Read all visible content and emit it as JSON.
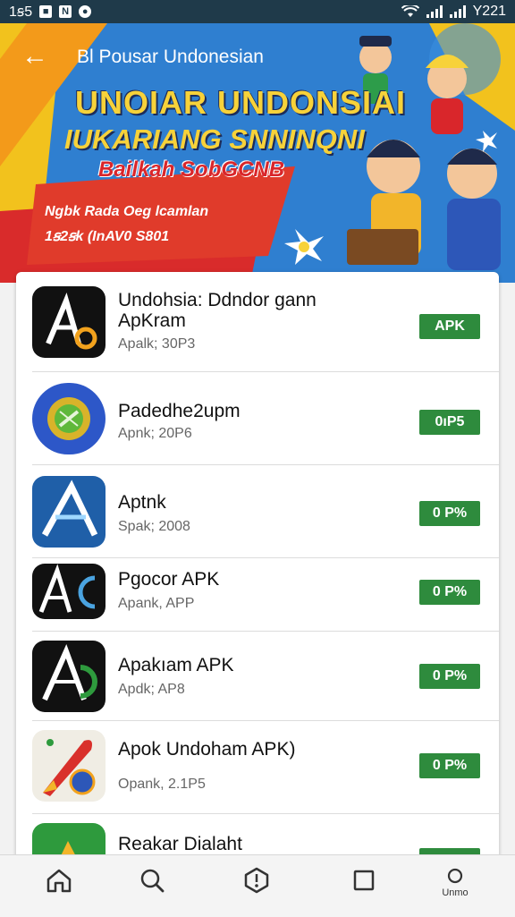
{
  "status": {
    "time": "1ꞩ5",
    "right_time": "Y221"
  },
  "hero": {
    "title": "Bl Pousar Undonesian",
    "headline1": "UNOIAR UNDONSIAI",
    "headline2": "IUKARIANG SNNINQNI",
    "headline3": "Bailkah SobGCNB",
    "promo_line1": "Ngbk Rada Oeg lcamlan",
    "promo_line2": "1ꞩ2ꞩk (InAV0 S801"
  },
  "apps": [
    {
      "name": "Undohsia: Ddndor gann ApKram",
      "sub": "Apalk; 30P3",
      "button": "APK"
    },
    {
      "name": "Padedhe2upm",
      "sub": "Apnk; 20P6",
      "button": "0ıP5"
    },
    {
      "name": "Aptnk",
      "sub": "Spak; 2008",
      "button": "0 P%"
    },
    {
      "name": "Pgocor APK",
      "sub": "Apank, APP",
      "button": "0 P%"
    },
    {
      "name": "Apakıam APK",
      "sub": "Apdk; AP8",
      "button": "0 P%"
    },
    {
      "name": "Apok Undoham APK)",
      "sub": "Opank, 2.1P5",
      "button": "0 P%"
    },
    {
      "name": "Reakar Dialaht",
      "sub": "",
      "button": ""
    }
  ],
  "nav": {
    "profile_label": "Unmo"
  },
  "colors": {
    "install_button": "#2e8b3d",
    "status_bar": "#1f3a4a",
    "headline": "#f7d23a"
  }
}
